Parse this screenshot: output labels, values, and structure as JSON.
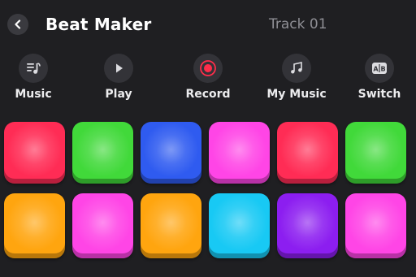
{
  "header": {
    "title": "Beat Maker",
    "track_name": "Track 01"
  },
  "toolbar": [
    {
      "label": "Music",
      "icon": "music-list-icon"
    },
    {
      "label": "Play",
      "icon": "play-icon"
    },
    {
      "label": "Record",
      "icon": "record-icon"
    },
    {
      "label": "My Music",
      "icon": "music-notes-icon"
    },
    {
      "label": "Switch",
      "icon": "ab-switch-icon"
    }
  ],
  "colors": {
    "background": "#1f1f22",
    "record_accent": "#ff2d4a",
    "pad_red": "#ff2c55",
    "pad_green": "#41d93a",
    "pad_blue": "#2f5bf0",
    "pad_pink": "#ff45e6",
    "pad_orange": "#ffa50f",
    "pad_cyan": "#18c9f4",
    "pad_purple": "#8c1ef0"
  },
  "pads": [
    [
      "pad_red",
      "pad_green",
      "pad_blue",
      "pad_pink",
      "pad_red",
      "pad_green"
    ],
    [
      "pad_orange",
      "pad_pink",
      "pad_orange",
      "pad_cyan",
      "pad_purple",
      "pad_pink"
    ]
  ]
}
